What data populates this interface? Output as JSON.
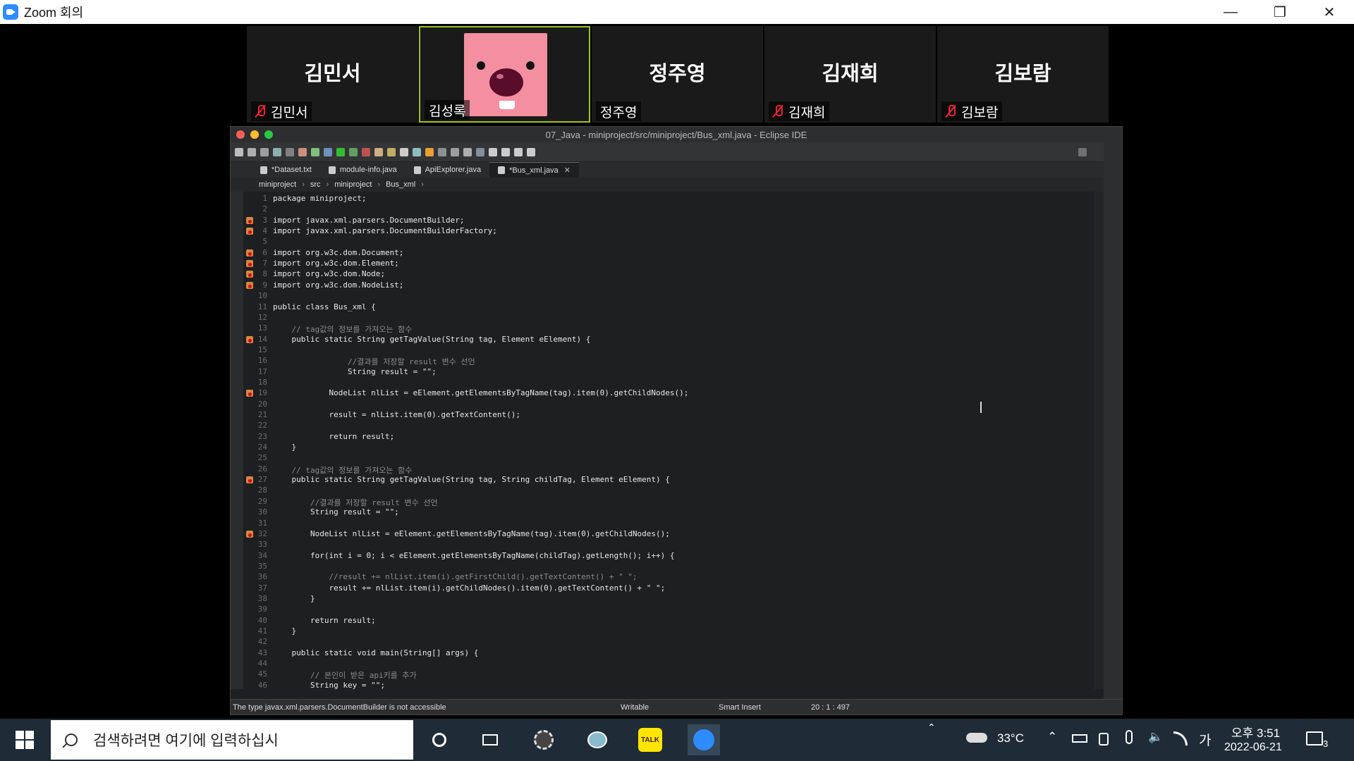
{
  "window": {
    "app_title": "Zoom 회의",
    "minimize": "—",
    "restore": "❐",
    "close": "✕"
  },
  "participants": [
    {
      "big_name": "김민서",
      "label": "김민서",
      "muted": true
    },
    {
      "big_name": "",
      "label": "김성록",
      "muted": false,
      "active_speaker": true
    },
    {
      "big_name": "정주영",
      "label": "정주영",
      "muted": false
    },
    {
      "big_name": "김재희",
      "label": "김재희",
      "muted": true
    },
    {
      "big_name": "김보람",
      "label": "김보람",
      "muted": true
    }
  ],
  "eclipse": {
    "window_title": "07_Java - miniproject/src/miniproject/Bus_xml.java - Eclipse IDE",
    "tabs": [
      {
        "label": "*Dataset.txt",
        "active": false
      },
      {
        "label": "module-info.java",
        "active": false
      },
      {
        "label": "ApiExplorer.java",
        "active": false
      },
      {
        "label": "*Bus_xml.java",
        "active": true
      }
    ],
    "breadcrumb": [
      "miniproject",
      "src",
      "miniproject",
      "Bus_xml"
    ],
    "lines": [
      {
        "n": "1",
        "t": "package miniproject;"
      },
      {
        "n": "2",
        "t": ""
      },
      {
        "n": "3",
        "t": "import javax.xml.parsers.DocumentBuilder;",
        "e": true
      },
      {
        "n": "4",
        "t": "import javax.xml.parsers.DocumentBuilderFactory;",
        "e": true
      },
      {
        "n": "5",
        "t": ""
      },
      {
        "n": "6",
        "t": "import org.w3c.dom.Document;",
        "e": true
      },
      {
        "n": "7",
        "t": "import org.w3c.dom.Element;",
        "e": true
      },
      {
        "n": "8",
        "t": "import org.w3c.dom.Node;",
        "e": true
      },
      {
        "n": "9",
        "t": "import org.w3c.dom.NodeList;",
        "e": true
      },
      {
        "n": "10",
        "t": ""
      },
      {
        "n": "11",
        "t": "public class Bus_xml {"
      },
      {
        "n": "12",
        "t": ""
      },
      {
        "n": "13",
        "t": "    // tag값의 정보를 가져오는 함수"
      },
      {
        "n": "14",
        "t": "    public static String getTagValue(String tag, Element eElement) {",
        "e": true
      },
      {
        "n": "15",
        "t": ""
      },
      {
        "n": "16",
        "t": "                //결과를 저장할 result 변수 선언"
      },
      {
        "n": "17",
        "t": "                String result = \"\";"
      },
      {
        "n": "18",
        "t": ""
      },
      {
        "n": "19",
        "t": "            NodeList nlList = eElement.getElementsByTagName(tag).item(0).getChildNodes();",
        "e": true
      },
      {
        "n": "20",
        "t": ""
      },
      {
        "n": "21",
        "t": "            result = nlList.item(0).getTextContent();"
      },
      {
        "n": "22",
        "t": ""
      },
      {
        "n": "23",
        "t": "            return result;"
      },
      {
        "n": "24",
        "t": "    }"
      },
      {
        "n": "25",
        "t": ""
      },
      {
        "n": "26",
        "t": "    // tag값의 정보를 가져오는 함수"
      },
      {
        "n": "27",
        "t": "    public static String getTagValue(String tag, String childTag, Element eElement) {",
        "e": true
      },
      {
        "n": "28",
        "t": ""
      },
      {
        "n": "29",
        "t": "        //결과를 저장할 result 변수 선언"
      },
      {
        "n": "30",
        "t": "        String result = \"\";"
      },
      {
        "n": "31",
        "t": ""
      },
      {
        "n": "32",
        "t": "        NodeList nlList = eElement.getElementsByTagName(tag).item(0).getChildNodes();",
        "e": true
      },
      {
        "n": "33",
        "t": ""
      },
      {
        "n": "34",
        "t": "        for(int i = 0; i < eElement.getElementsByTagName(childTag).getLength(); i++) {"
      },
      {
        "n": "35",
        "t": ""
      },
      {
        "n": "36",
        "t": "            //result += nlList.item(i).getFirstChild().getTextContent() + \" \";"
      },
      {
        "n": "37",
        "t": "            result += nlList.item(i).getChildNodes().item(0).getTextContent() + \" \";"
      },
      {
        "n": "38",
        "t": "        }"
      },
      {
        "n": "39",
        "t": ""
      },
      {
        "n": "40",
        "t": "        return result;"
      },
      {
        "n": "41",
        "t": "    }"
      },
      {
        "n": "42",
        "t": ""
      },
      {
        "n": "43",
        "t": "    public static void main(String[] args) {"
      },
      {
        "n": "44",
        "t": ""
      },
      {
        "n": "45",
        "t": "        // 본인이 받은 api키를 추가"
      },
      {
        "n": "46",
        "t": "        String key = \"\";"
      }
    ],
    "status": {
      "message": "The type javax.xml.parsers.DocumentBuilder is not accessible",
      "writable": "Writable",
      "insert": "Smart Insert",
      "position": "20 : 1 : 497"
    }
  },
  "taskbar": {
    "search_placeholder": "검색하려면 여기에 입력하십시",
    "weather": "33°C",
    "ime": "가",
    "time": "오후 3:51",
    "date": "2022-06-21",
    "notifications": "3",
    "talk_label": "TALK"
  }
}
